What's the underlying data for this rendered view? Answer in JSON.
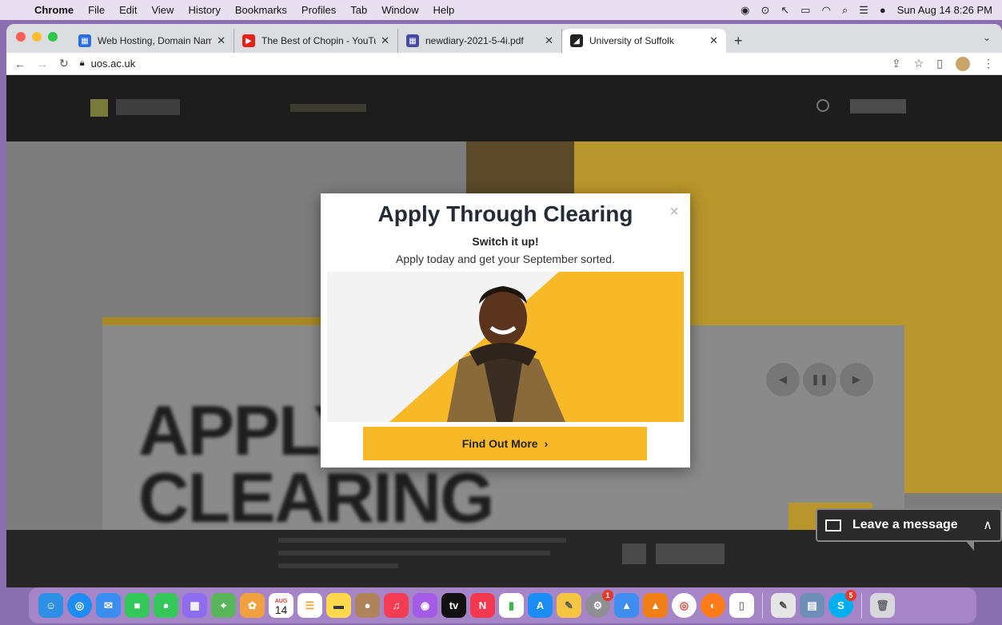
{
  "menubar": {
    "app_name": "Chrome",
    "items": [
      "File",
      "Edit",
      "View",
      "History",
      "Bookmarks",
      "Profiles",
      "Tab",
      "Window",
      "Help"
    ],
    "clock": "Sun Aug 14  8:26 PM"
  },
  "tabs": [
    {
      "title": "Web Hosting, Domain Names, |",
      "favicon": "grid-icon",
      "color": "#2a6fe0"
    },
    {
      "title": "The Best of Chopin - YouTube",
      "favicon": "youtube-icon",
      "color": "#e62117"
    },
    {
      "title": "newdiary-2021-5-4i.pdf",
      "favicon": "pdf-icon",
      "color": "#444a9c"
    },
    {
      "title": "University of Suffolk",
      "favicon": "suffolk-icon",
      "color": "#222222"
    }
  ],
  "toolbar": {
    "url": "uos.ac.uk"
  },
  "background_page": {
    "big_text_line1": "APPLY",
    "big_text_line2": "CLEARING"
  },
  "modal": {
    "title": "Apply Through Clearing",
    "subtitle": "Switch it up!",
    "description": "Apply today and get your September sorted.",
    "cta_label": "Find Out More",
    "close_glyph": "×"
  },
  "chat_widget": {
    "label": "Leave a message"
  },
  "dock": {
    "calendar_month": "AUG",
    "calendar_day": "14",
    "system_prefs_badge": "1",
    "skype_badge": "5"
  },
  "colors": {
    "accent_yellow": "#f8b928",
    "modal_title": "#222b36"
  }
}
